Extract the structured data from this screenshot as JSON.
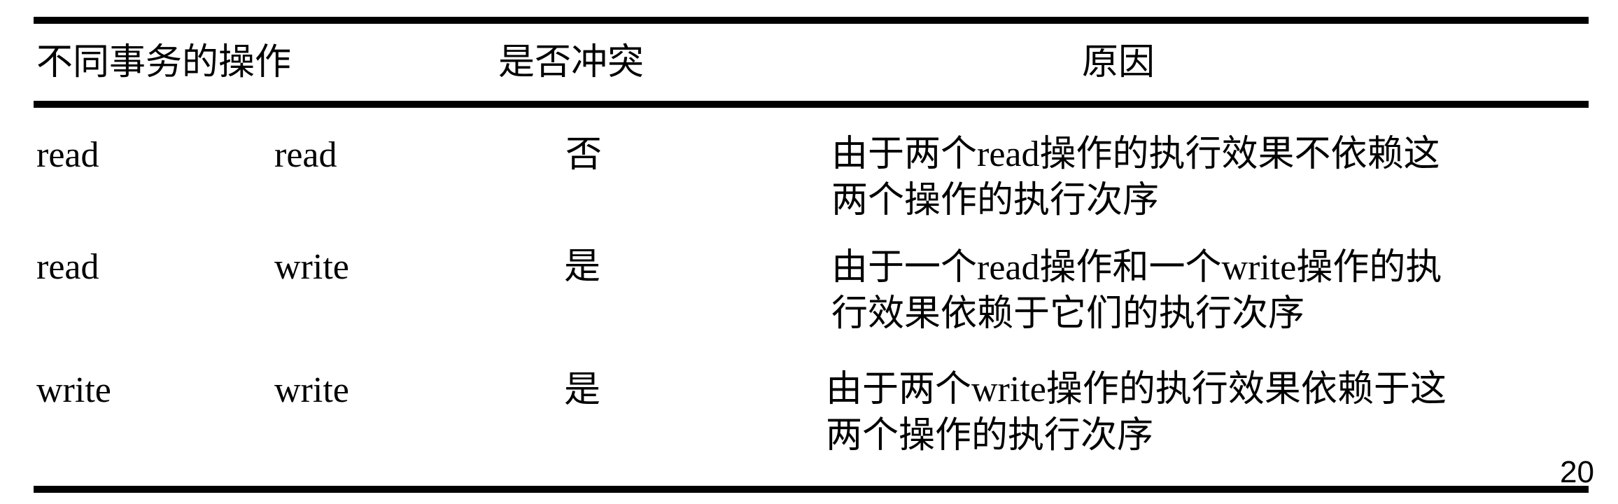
{
  "header": {
    "ops": "不同事务的操作",
    "conflict": "是否冲突",
    "reason": "原因"
  },
  "rows": [
    {
      "op1": "read",
      "op2": "read",
      "conflict": "否",
      "reason_line1": "由于两个read操作的执行效果不依赖这",
      "reason_line2": "两个操作的执行次序"
    },
    {
      "op1": "read",
      "op2": "write",
      "conflict": "是",
      "reason_line1": "由于一个read操作和一个write操作的执",
      "reason_line2": "行效果依赖于它们的执行次序"
    },
    {
      "op1": "write",
      "op2": "write",
      "conflict": "是",
      "reason_line1": "由于两个write操作的执行效果依赖于这",
      "reason_line2": "两个操作的执行次序"
    }
  ],
  "page_number": "20"
}
